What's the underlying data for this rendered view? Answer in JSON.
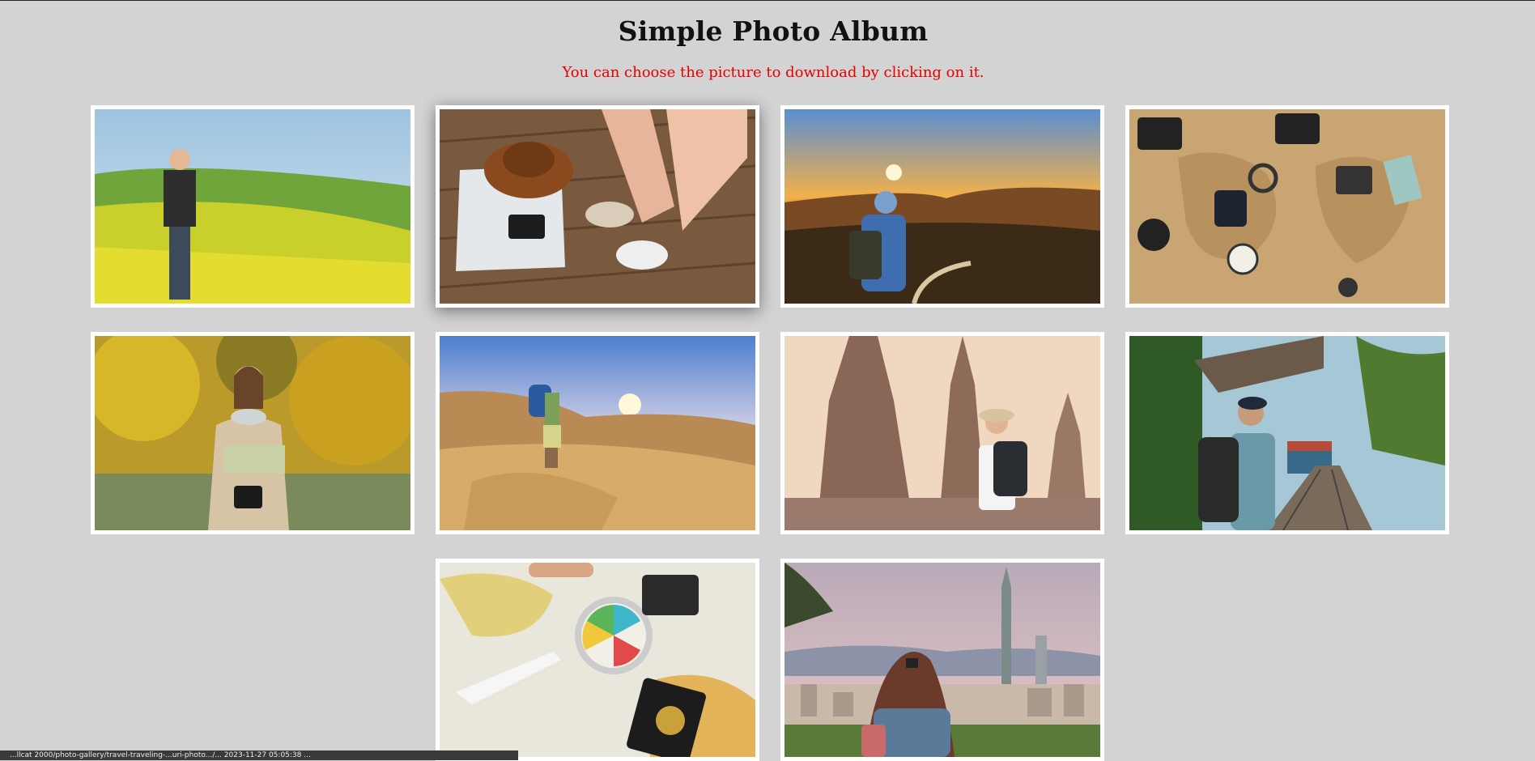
{
  "header": {
    "title": "Simple Photo Album",
    "subtitle": "You can choose the picture to download by clicking on it."
  },
  "colors": {
    "background": "#d3d3d3",
    "subtitle": "#e60000",
    "frame": "#ffffff"
  },
  "status_bar": {
    "text": "...llcat 2000/photo-gallery/travel-traveling-...uri-photo.../...  2023-11-27 05:05:38  ..."
  }
}
